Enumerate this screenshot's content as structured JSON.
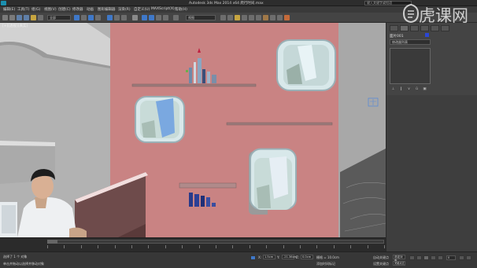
{
  "window": {
    "title": "Autodesk 3ds Max 2014 x64    爬行时间.max",
    "search_placeholder": "键入关键字或短语"
  },
  "menu": [
    {
      "id": "edit",
      "label": "编辑(E)"
    },
    {
      "id": "tools",
      "label": "工具(T)"
    },
    {
      "id": "group",
      "label": "组(G)"
    },
    {
      "id": "views",
      "label": "视图(V)"
    },
    {
      "id": "create",
      "label": "创建(C)"
    },
    {
      "id": "modifiers",
      "label": "修改器"
    },
    {
      "id": "animation",
      "label": "动画"
    },
    {
      "id": "graph",
      "label": "图形编辑器"
    },
    {
      "id": "rendering",
      "label": "渲染(R)"
    },
    {
      "id": "customize",
      "label": "自定义(U)"
    },
    {
      "id": "maxscript",
      "label": "MAXScript(X)"
    },
    {
      "id": "help",
      "label": "帮助(H)"
    }
  ],
  "toolbar": {
    "selection_filter": "全部",
    "reference_coord": "视图"
  },
  "viewport": {
    "label": "[+][透视][真实]",
    "wall_color": "#c98383"
  },
  "command_panel": {
    "object_name": "面片001",
    "modifier_list": "修改器列表",
    "name_color": "#2a46d6"
  },
  "timeline": {
    "frame_display": "0 / 100"
  },
  "status": {
    "selection": "选择了 1 个 对象",
    "prompt": "单击并拖动以选择并移动对象",
    "x_label": "X:",
    "y_label": "Y:",
    "z_label": "Z:",
    "x": "1.5cm",
    "y": "-21.36cm",
    "z": "0.0cm",
    "grid": "栅格 = 10.0cm",
    "add_time_tag": "添加时间标记",
    "auto_key": "自动关键点",
    "selected": "选定对象",
    "set_key": "设置关键点",
    "key_filters": "关键点过滤器...",
    "frame": "0"
  },
  "watermark": {
    "text": "虎课网"
  }
}
